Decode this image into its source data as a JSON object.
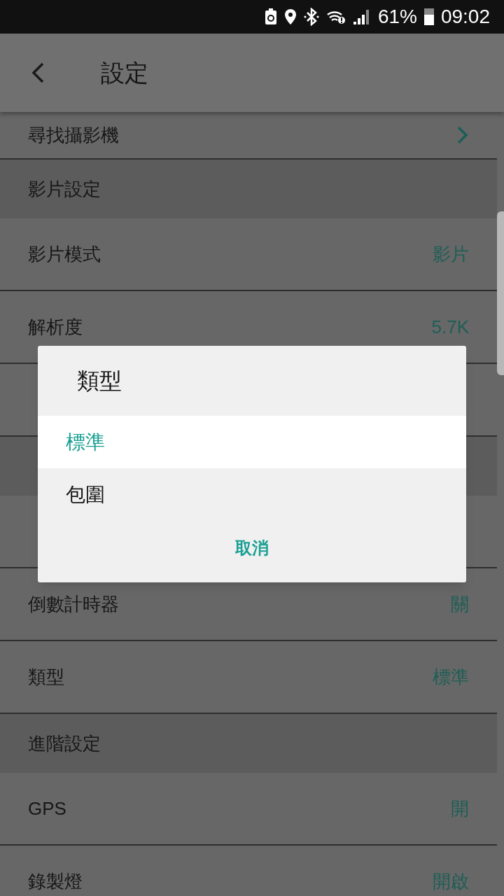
{
  "status_bar": {
    "battery_percent": "61%",
    "time": "09:02"
  },
  "app_bar": {
    "title": "設定"
  },
  "settings": [
    {
      "kind": "link",
      "label": "尋找攝影機"
    },
    {
      "kind": "section",
      "label": "影片設定"
    },
    {
      "kind": "row",
      "label": "影片模式",
      "value": "影片"
    },
    {
      "kind": "row",
      "label": "解析度",
      "value": "5.7K"
    },
    {
      "kind": "row"
    },
    {
      "kind": "section"
    },
    {
      "kind": "row"
    },
    {
      "kind": "row",
      "label": "倒數計時器",
      "value": "關"
    },
    {
      "kind": "row",
      "label": "類型",
      "value": "標準"
    },
    {
      "kind": "section",
      "label": "進階設定"
    },
    {
      "kind": "row",
      "label": "GPS",
      "value": "開"
    },
    {
      "kind": "row",
      "label": "錄製燈",
      "value": "開啟"
    }
  ],
  "dialog": {
    "title": "類型",
    "options": [
      {
        "label": "標準",
        "selected": true
      },
      {
        "label": "包圍",
        "selected": false
      }
    ],
    "cancel": "取消"
  }
}
